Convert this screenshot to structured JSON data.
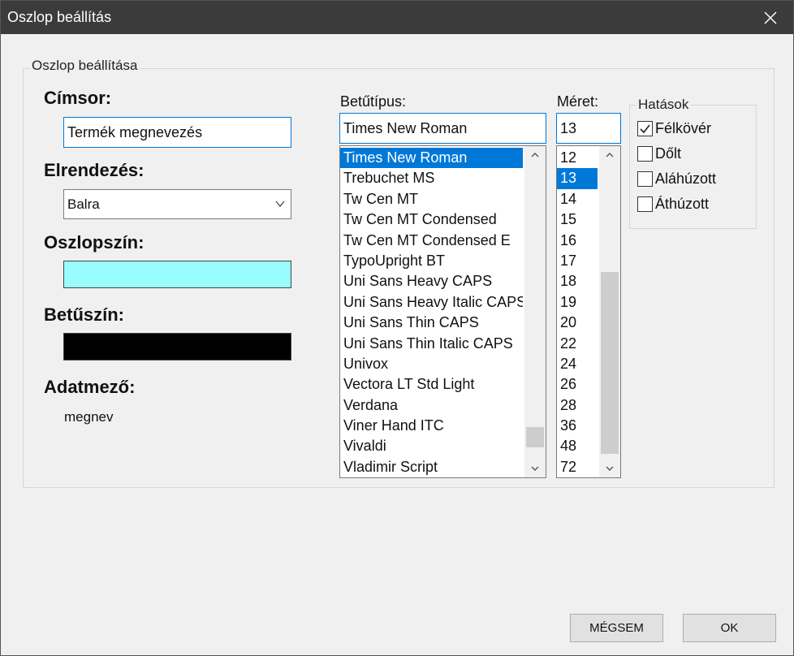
{
  "window": {
    "title": "Oszlop beállítás",
    "close_icon": "close-icon"
  },
  "group": {
    "label": "Oszlop beállítása"
  },
  "header": {
    "label": "Címsor:",
    "value": "Termék megnevezés"
  },
  "alignment": {
    "label": "Elrendezés:",
    "value": "Balra"
  },
  "column_color": {
    "label": "Oszlopszín:",
    "color": "#99fcfc"
  },
  "font_color": {
    "label": "Betűszín:",
    "color": "#000000"
  },
  "data_field": {
    "label": "Adatmező:",
    "value": "megnev"
  },
  "font": {
    "label": "Betűtípus:",
    "value": "Times New Roman",
    "items": [
      "Times New Roman",
      "Trebuchet MS",
      "Tw Cen MT",
      "Tw Cen MT Condensed",
      "Tw Cen MT Condensed E",
      "TypoUpright BT",
      "Uni Sans Heavy CAPS",
      "Uni Sans Heavy Italic CAPS",
      "Uni Sans Thin CAPS",
      "Uni Sans Thin Italic CAPS",
      "Univox",
      "Vectora LT Std Light",
      "Verdana",
      "Viner Hand ITC",
      "Vivaldi",
      "Vladimir Script"
    ],
    "selected_index": 0
  },
  "size": {
    "label": "Méret:",
    "value": "13",
    "items": [
      "12",
      "13",
      "14",
      "15",
      "16",
      "17",
      "18",
      "19",
      "20",
      "22",
      "24",
      "26",
      "28",
      "36",
      "48",
      "72"
    ],
    "selected_index": 1
  },
  "effects": {
    "label": "Hatások",
    "bold": {
      "label": "Félkövér",
      "checked": true
    },
    "italic": {
      "label": "Dőlt",
      "checked": false
    },
    "underline": {
      "label": "Aláhúzott",
      "checked": false
    },
    "strikeout": {
      "label": "Áthúzott",
      "checked": false
    }
  },
  "buttons": {
    "cancel": "MÉGSEM",
    "ok": "OK"
  }
}
